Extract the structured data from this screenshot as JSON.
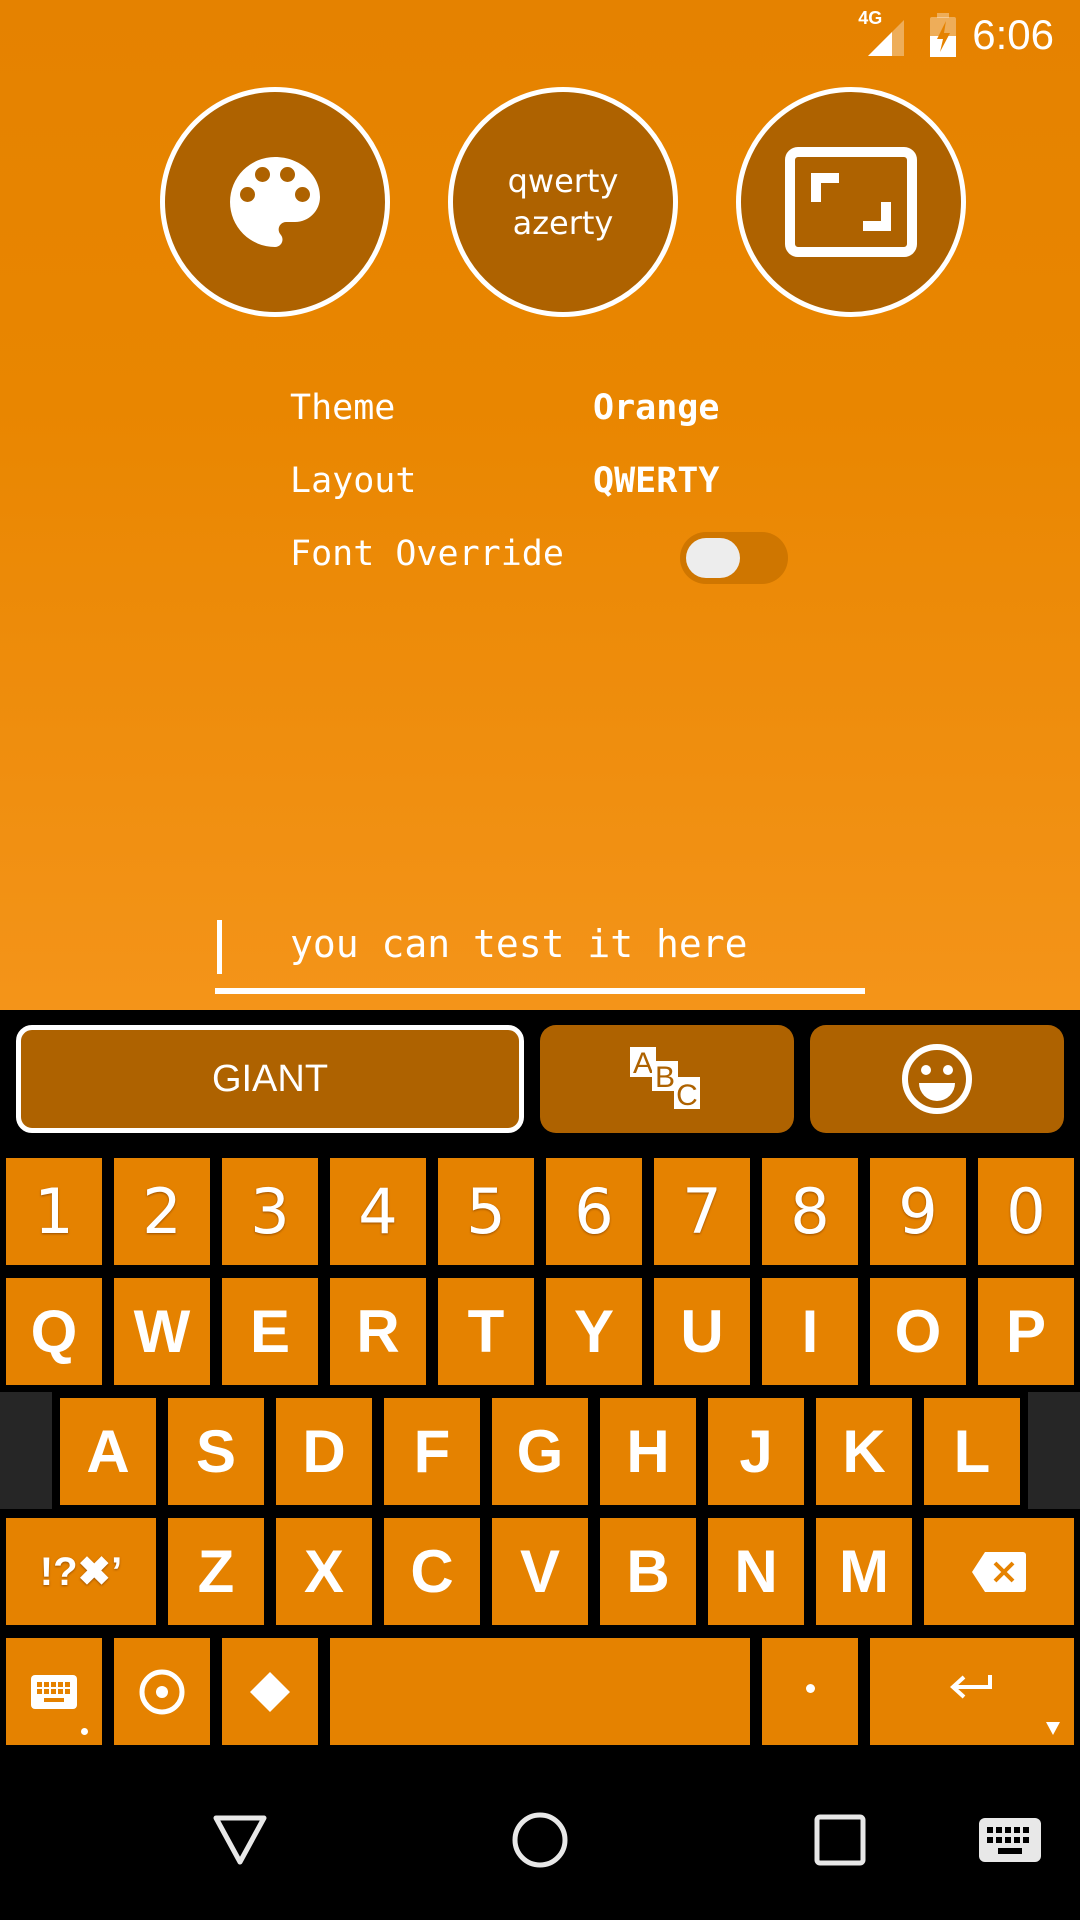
{
  "status_bar": {
    "network_label": "4G",
    "time": "6:06",
    "icons": [
      "signal-icon",
      "battery-charging-icon"
    ]
  },
  "top_buttons": [
    {
      "name": "theme-button",
      "icon": "palette-icon"
    },
    {
      "name": "layout-button",
      "line1": "qwerty",
      "line2": "azerty"
    },
    {
      "name": "size-button",
      "icon": "resize-icon"
    }
  ],
  "settings": {
    "theme_label": "Theme",
    "theme_value": "Orange",
    "layout_label": "Layout",
    "layout_value": "QWERTY",
    "font_override_label": "Font Override",
    "font_override_enabled": false
  },
  "test_input": {
    "placeholder": "you can test it here",
    "value": ""
  },
  "keyboard": {
    "toolbar": {
      "size_label": "GIANT",
      "abc_icon": "abc-icon",
      "emoji_icon": "emoji-icon"
    },
    "number_row": [
      "1",
      "2",
      "3",
      "4",
      "5",
      "6",
      "7",
      "8",
      "9",
      "0"
    ],
    "row1": [
      "Q",
      "W",
      "E",
      "R",
      "T",
      "Y",
      "U",
      "I",
      "O",
      "P"
    ],
    "row2": [
      "A",
      "S",
      "D",
      "F",
      "G",
      "H",
      "J",
      "K",
      "L"
    ],
    "row3": [
      "Z",
      "X",
      "C",
      "V",
      "B",
      "N",
      "M"
    ],
    "symbols_label": "!?✖’",
    "period_label": "·",
    "colors": {
      "key": "#e58200",
      "toolbar": "#ae6200",
      "background": "#000000"
    }
  },
  "nav_bar": {
    "icons": [
      "back-icon",
      "home-icon",
      "recents-icon",
      "keyboard-switch-icon"
    ]
  }
}
